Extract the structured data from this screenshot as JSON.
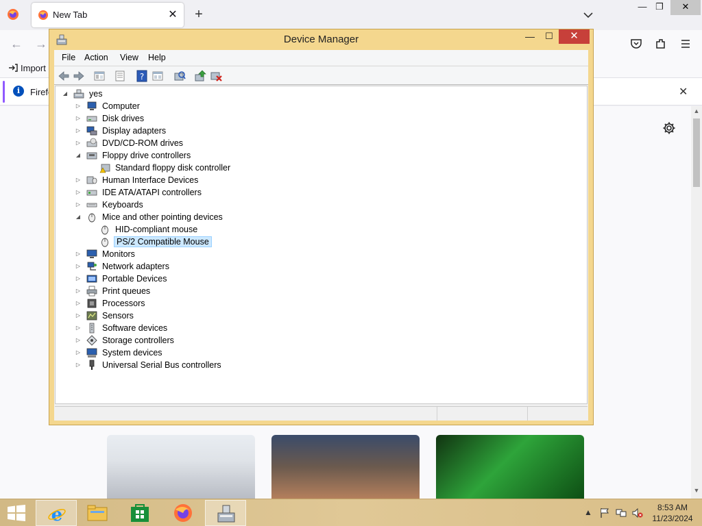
{
  "browser": {
    "tab": {
      "label": "New Tab",
      "close": "✕"
    },
    "newtab_label": "+",
    "controls": {
      "minimize": "—",
      "maximize": "❐",
      "close": "✕"
    },
    "nav": {
      "back": "←",
      "forward": "→"
    },
    "bookmarks": {
      "import_label": "Import"
    },
    "notification": {
      "text": "Firefo",
      "info": "i",
      "close": "✕"
    },
    "icons": [
      "firefox-icon",
      "chevron-down-icon",
      "pocket-icon",
      "extensions-icon",
      "menu-icon",
      "gear-icon"
    ]
  },
  "device_manager": {
    "title": "Device Manager",
    "controls": {
      "minimize": "—",
      "maximize": "☐",
      "close": "✕"
    },
    "menu": [
      "File",
      "Action",
      "View",
      "Help"
    ],
    "toolbar": [
      "back-icon",
      "forward-icon",
      "show-hide-tree-icon",
      "properties-icon",
      "help-icon",
      "view-icon",
      "scan-hardware-icon",
      "update-driver-icon",
      "uninstall-icon"
    ],
    "tree": {
      "root": "yes",
      "items": [
        {
          "label": "Computer",
          "expanded": false
        },
        {
          "label": "Disk drives",
          "expanded": false
        },
        {
          "label": "Display adapters",
          "expanded": false
        },
        {
          "label": "DVD/CD-ROM drives",
          "expanded": false
        },
        {
          "label": "Floppy drive controllers",
          "expanded": true,
          "children": [
            "Standard floppy disk controller"
          ]
        },
        {
          "label": "Human Interface Devices",
          "expanded": false
        },
        {
          "label": "IDE ATA/ATAPI controllers",
          "expanded": false
        },
        {
          "label": "Keyboards",
          "expanded": false
        },
        {
          "label": "Mice and other pointing devices",
          "expanded": true,
          "children": [
            "HID-compliant mouse",
            "PS/2 Compatible Mouse"
          ]
        },
        {
          "label": "Monitors",
          "expanded": false
        },
        {
          "label": "Network adapters",
          "expanded": false
        },
        {
          "label": "Portable Devices",
          "expanded": false
        },
        {
          "label": "Print queues",
          "expanded": false
        },
        {
          "label": "Processors",
          "expanded": false
        },
        {
          "label": "Sensors",
          "expanded": false
        },
        {
          "label": "Software devices",
          "expanded": false
        },
        {
          "label": "Storage controllers",
          "expanded": false
        },
        {
          "label": "System devices",
          "expanded": false
        },
        {
          "label": "Universal Serial Bus controllers",
          "expanded": false
        }
      ],
      "selected": "PS/2 Compatible Mouse"
    }
  },
  "taskbar": {
    "apps": [
      "internet-explorer-icon",
      "file-explorer-icon",
      "store-icon",
      "firefox-icon",
      "device-manager-icon"
    ],
    "active_app": "device-manager-icon",
    "tray": {
      "chevron": "▲"
    },
    "clock": {
      "time": "8:53 AM",
      "date": "11/23/2024"
    }
  },
  "colors": {
    "window_frame": "#f4d78e",
    "close_button": "#c7403a",
    "selection": "#cce8ff",
    "taskbar": "#dcc28f",
    "firefox_accent": "#9059ff"
  }
}
